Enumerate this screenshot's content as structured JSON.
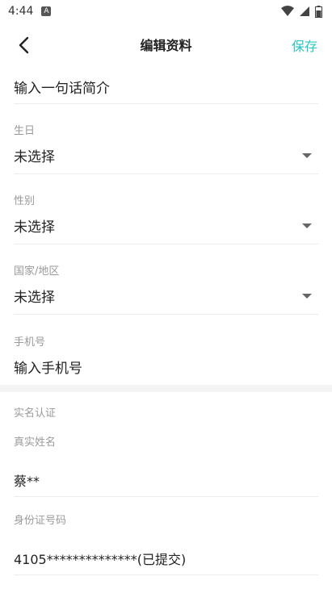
{
  "status_bar": {
    "time": "4:44",
    "notif_icon_letter": "A"
  },
  "topbar": {
    "title": "编辑资料",
    "save_label": "保存"
  },
  "bio": {
    "placeholder": "输入一句话简介"
  },
  "birthday": {
    "label": "生日",
    "value": "未选择"
  },
  "gender": {
    "label": "性别",
    "value": "未选择"
  },
  "country": {
    "label": "国家/地区",
    "value": "未选择"
  },
  "phone": {
    "label": "手机号",
    "placeholder": "输入手机号"
  },
  "realname_section": {
    "title": "实名认证",
    "name_label": "真实姓名",
    "name_value": "蔡**",
    "id_label": "身份证号码",
    "id_value": "4105**************(已提交)"
  },
  "colors": {
    "accent": "#2bc4c0",
    "label_gray": "#9a9a9a",
    "divider": "#ececec"
  }
}
